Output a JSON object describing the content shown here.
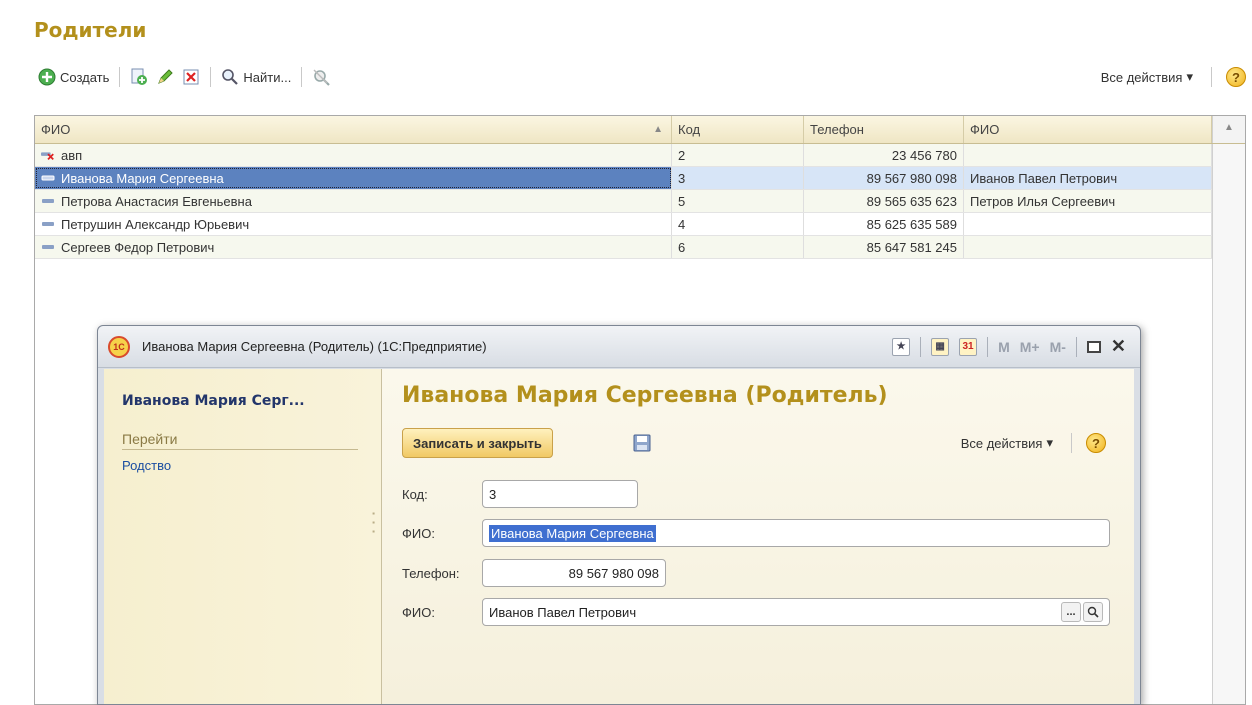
{
  "page": {
    "title": "Родители"
  },
  "toolbar": {
    "create_label": "Создать",
    "find_label": "Найти...",
    "all_actions_label": "Все действия"
  },
  "grid": {
    "columns": [
      "ФИО",
      "Код",
      "Телефон",
      "ФИО"
    ],
    "rows": [
      {
        "name": "авп",
        "code": "2",
        "phone": "23 456 780",
        "fio": "",
        "icon": "deleted-item-icon"
      },
      {
        "name": "Иванова Мария Сергеевна",
        "code": "3",
        "phone": "89 567 980 098",
        "fio": "Иванов Павел Петрович",
        "icon": "item-icon",
        "selected": true
      },
      {
        "name": "Петрова Анастасия Евгеньевна",
        "code": "5",
        "phone": "89 565 635 623",
        "fio": "Петров Илья Сергеевич",
        "icon": "item-icon"
      },
      {
        "name": "Петрушин Александр Юрьевич",
        "code": "4",
        "phone": "85 625 635 589",
        "fio": "",
        "icon": "item-icon"
      },
      {
        "name": "Сергеев Федор Петрович",
        "code": "6",
        "phone": "85 647 581 245",
        "fio": "",
        "icon": "item-icon"
      }
    ]
  },
  "dialog": {
    "window_title": "Иванова Мария Сергеевна (Родитель)  (1С:Предприятие)",
    "logo_text": "1С",
    "tools": {
      "m": "M",
      "m_plus": "M+",
      "m_minus": "M-"
    },
    "nav": {
      "title": "Иванова Мария Серг...",
      "group": "Перейти",
      "link": "Родство"
    },
    "form": {
      "title": "Иванова Мария Сергеевна (Родитель)",
      "save_close_label": "Записать и закрыть",
      "all_actions_label": "Все действия",
      "code_label": "Код:",
      "code_value": "3",
      "fio_label": "ФИО:",
      "fio_value": "Иванова Мария Сергеевна",
      "phone_label": "Телефон:",
      "phone_value": "89 567 980 098",
      "fio2_label": "ФИО:",
      "fio2_value": "Иванов Павел Петрович",
      "pick_label": "..."
    }
  },
  "colors": {
    "accent": "#b3901c",
    "selection": "#5c82bf",
    "link": "#1b4ea1"
  }
}
